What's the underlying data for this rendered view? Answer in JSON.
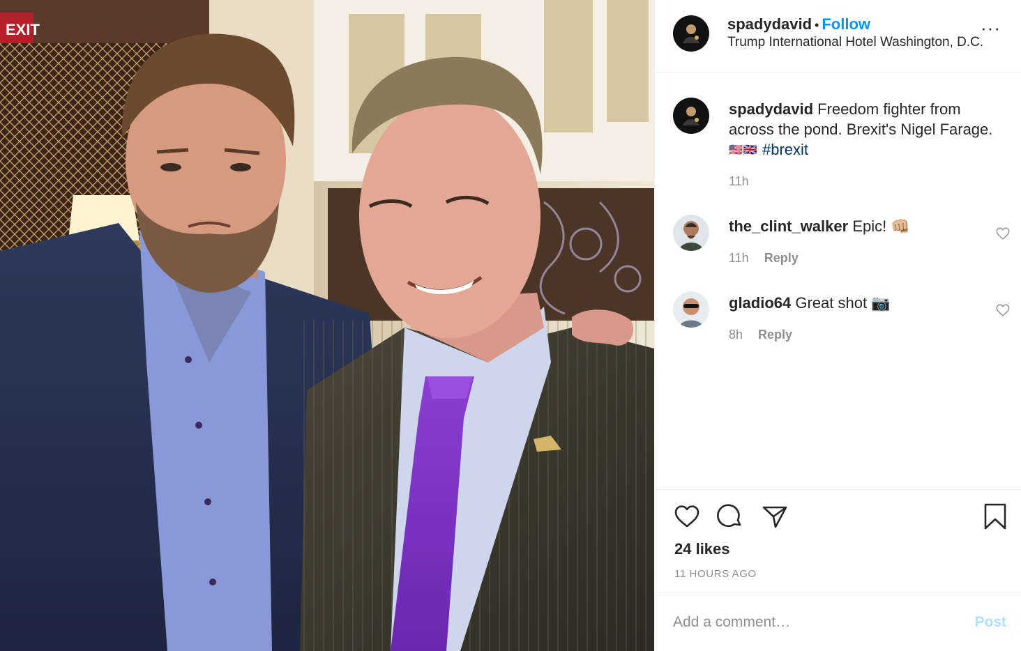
{
  "post": {
    "username": "spadydavid",
    "separator": "•",
    "follow_label": "Follow",
    "location": "Trump International Hotel Washington, D.C.",
    "more_icon": "more-options-icon"
  },
  "photo": {
    "sign_text": "EXIT"
  },
  "caption": {
    "username": "spadydavid",
    "text": "Freedom fighter from across the pond. Brexit's Nigel Farage.",
    "flags": "🇺🇸🇬🇧",
    "hashtag": "#brexit",
    "time": "11h"
  },
  "comments": [
    {
      "username": "the_clint_walker",
      "text": "Epic! 👊🏼",
      "time": "11h",
      "reply_label": "Reply"
    },
    {
      "username": "gladio64",
      "text": "Great shot 📷",
      "time": "8h",
      "reply_label": "Reply"
    }
  ],
  "actions": {
    "likes": "24 likes",
    "time_ago": "11 HOURS AGO"
  },
  "add_comment": {
    "placeholder": "Add a comment…",
    "post_label": "Post"
  },
  "colors": {
    "accent": "#0095f6",
    "post_disabled": "#b2dffc",
    "secondary_text": "#8e8e8e"
  }
}
